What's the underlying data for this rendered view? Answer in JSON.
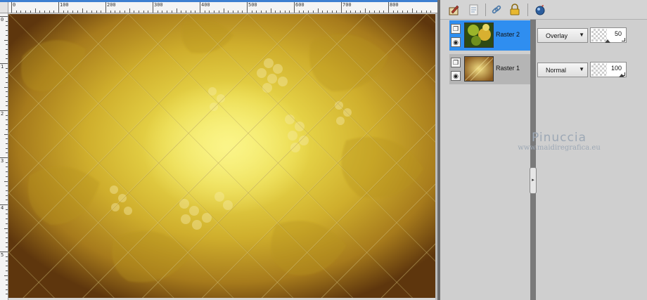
{
  "ruler": {
    "labels": [
      "0",
      "100",
      "200",
      "300",
      "400",
      "500",
      "600",
      "700",
      "800"
    ],
    "vertical_labels": [
      "0",
      "1",
      "2",
      "3",
      "4",
      "5"
    ]
  },
  "toolbar": {
    "icons": [
      "new-layer-icon",
      "layer-properties-icon",
      "link-icon",
      "lock-icon",
      "mask-icon"
    ]
  },
  "layers": [
    {
      "name": "Raster 2",
      "blend_mode": "Overlay",
      "opacity": "50",
      "opacity_level": 50,
      "selected": true
    },
    {
      "name": "Raster 1",
      "blend_mode": "Normal",
      "opacity": "100",
      "opacity_level": 100,
      "selected": false
    }
  ],
  "watermark": {
    "name": "Pinuccia",
    "url": "www.maidiregrafica.eu"
  },
  "colors": {
    "selection": "#2f8ef0",
    "accent_top": "#3d7fd1",
    "canvas_gold": "#d7b832"
  }
}
